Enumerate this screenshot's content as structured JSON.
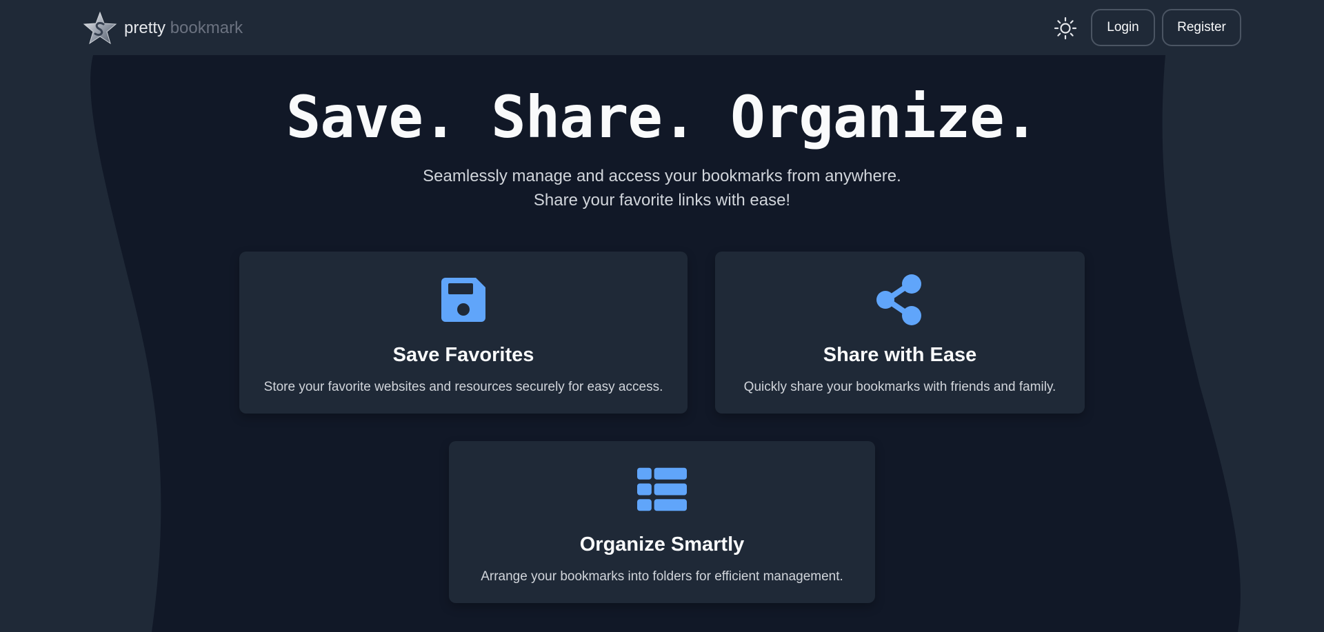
{
  "brand": {
    "word1": "pretty",
    "word2": "bookmark",
    "logo_icon": "star-logo-icon"
  },
  "nav": {
    "theme_icon": "sun-icon",
    "login_label": "Login",
    "register_label": "Register"
  },
  "hero": {
    "title": "Save. Share. Organize.",
    "subtitle_line1": "Seamlessly manage and access your bookmarks from anywhere.",
    "subtitle_line2": "Share your favorite links with ease!"
  },
  "features": [
    {
      "icon": "floppy-disk-icon",
      "title": "Save Favorites",
      "description": "Store your favorite websites and resources securely for easy access."
    },
    {
      "icon": "share-icon",
      "title": "Share with Ease",
      "description": "Quickly share your bookmarks with friends and family."
    },
    {
      "icon": "list-icon",
      "title": "Organize Smartly",
      "description": "Arrange your bookmarks into folders for efficient management."
    }
  ],
  "colors": {
    "background": "#1f2937",
    "hero_blob": "#111827",
    "card": "#1f2937",
    "accent_icon": "#60a5fa",
    "muted_text": "#6b7280"
  }
}
